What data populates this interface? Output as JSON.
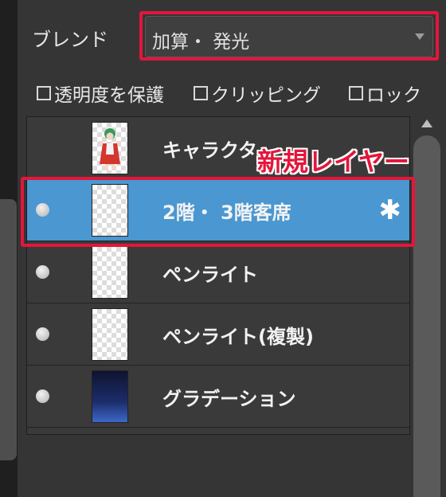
{
  "blend": {
    "label": "ブレンド",
    "value": "加算・ 発光"
  },
  "options": [
    {
      "label": "透明度を保護"
    },
    {
      "label": "クリッピング"
    },
    {
      "label": "ロック"
    }
  ],
  "layers": [
    {
      "name": "キャラクタ"
    },
    {
      "name": "2階・ 3階客席",
      "selected": true
    },
    {
      "name": "ペンライト"
    },
    {
      "name": "ペンライト(複製)"
    },
    {
      "name": "グラデーション"
    }
  ],
  "annotation": {
    "label": "新規レイヤー"
  },
  "colors": {
    "highlight": "#e3163b",
    "selected_row": "#4a97d1"
  }
}
